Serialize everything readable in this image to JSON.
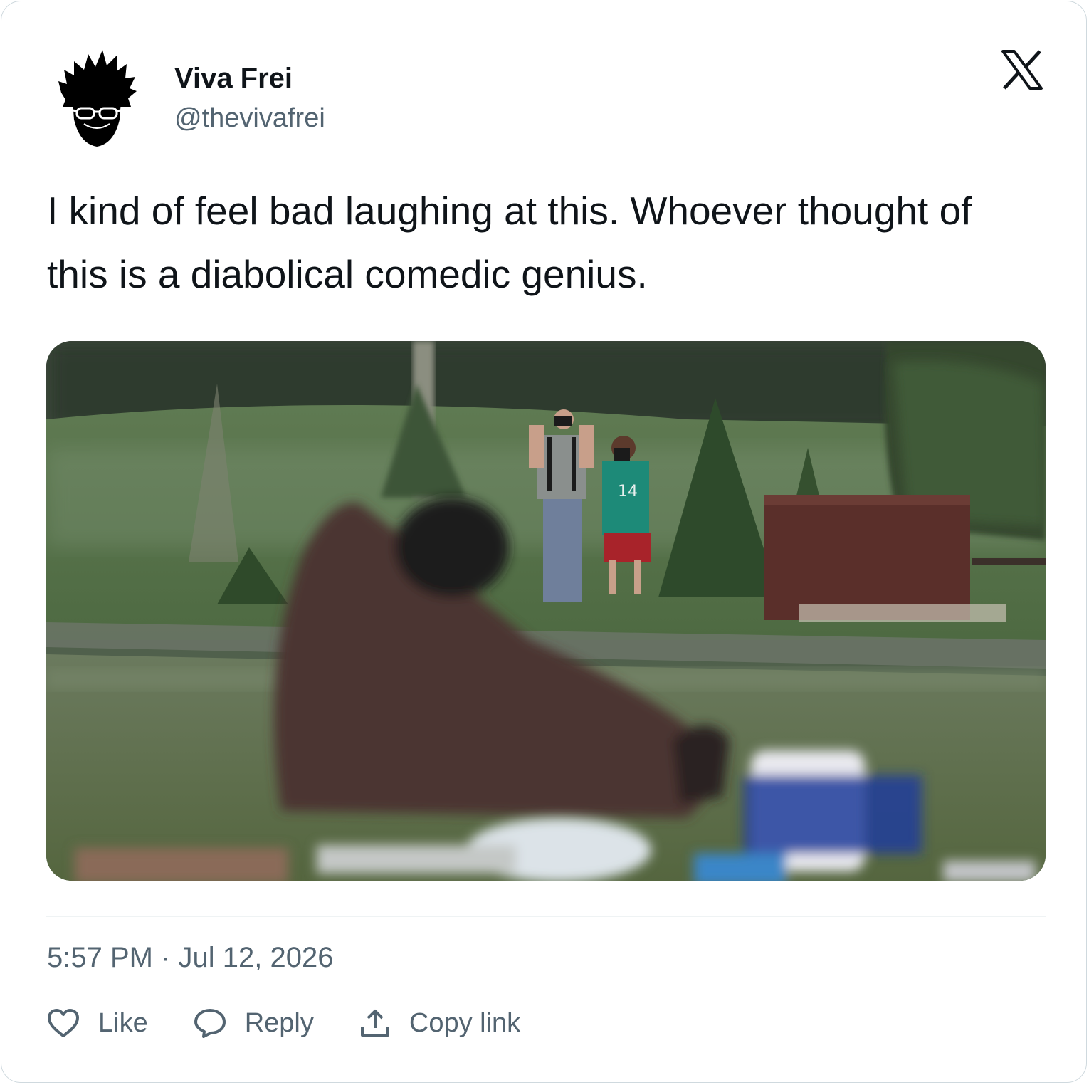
{
  "author": {
    "name": "Viva Frei",
    "handle": "@thevivafrei",
    "avatar_icon": "flame-hair-sunglasses-avatar"
  },
  "brand": {
    "logo_icon": "x-logo-icon"
  },
  "tweet": {
    "text": "I kind of feel bad laughing at this. Whoever thought of this is a diabolical comedic genius."
  },
  "media": {
    "type": "image",
    "jersey_number": "14"
  },
  "meta": {
    "time": "5:57 PM",
    "separator": "·",
    "date": "Jul 12, 2026"
  },
  "actions": {
    "like_label": "Like",
    "reply_label": "Reply",
    "copy_label": "Copy link"
  },
  "colors": {
    "text_primary": "#0f1419",
    "text_secondary": "#536471",
    "border": "#cfd9de"
  }
}
